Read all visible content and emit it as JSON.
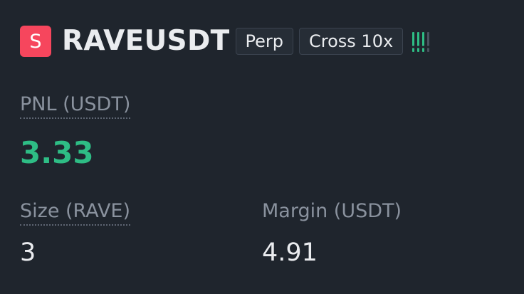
{
  "position": {
    "side_badge": "S",
    "symbol": "RAVEUSDT",
    "contract_type": "Perp",
    "margin_mode": "Cross 10x",
    "risk_icon": "risk-level-bars-icon",
    "risk_text": "!!!!"
  },
  "pnl": {
    "label": "PNL (USDT)",
    "value": "3.33"
  },
  "size": {
    "label": "Size (RAVE)",
    "value": "3"
  },
  "margin": {
    "label": "Margin (USDT)",
    "value": "4.91"
  },
  "colors": {
    "background": "#1f252d",
    "short_badge": "#f6465d",
    "profit": "#2ebd85",
    "label": "#8a929e",
    "text": "#eaecef"
  }
}
